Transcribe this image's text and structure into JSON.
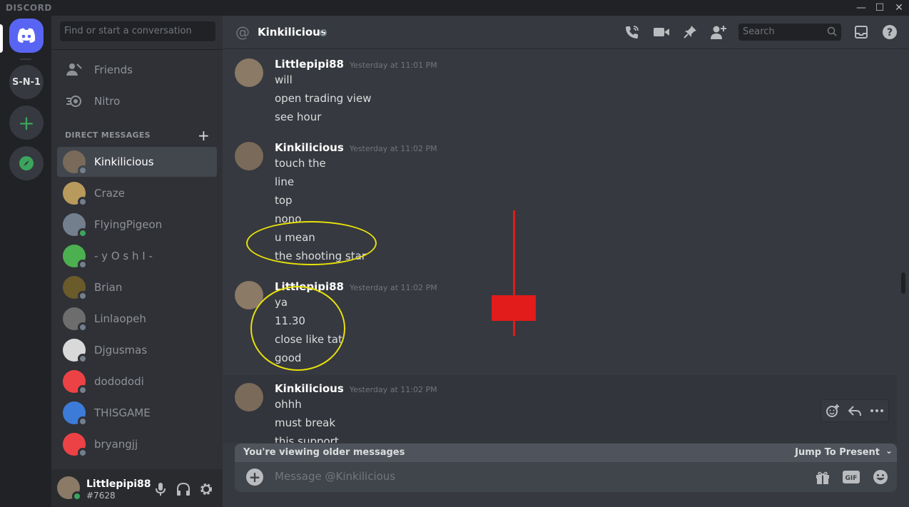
{
  "titlebar": {
    "brand": "DISCORD",
    "minimize": "—",
    "maximize": "☐",
    "close": "✕"
  },
  "rail": {
    "server_text": "S-N-1",
    "add_symbol": "+"
  },
  "dm_sidebar": {
    "search_placeholder": "Find or start a conversation",
    "nav": [
      {
        "label": "Friends",
        "icon": "friends-icon"
      },
      {
        "label": "Nitro",
        "icon": "nitro-icon"
      }
    ],
    "section_title": "DIRECT MESSAGES",
    "add_symbol": "+",
    "dms": [
      {
        "name": "Kinkilicious",
        "status": "offline",
        "color": "#7a6a5a",
        "active": true
      },
      {
        "name": "Craze",
        "status": "offline",
        "color": "#b89a5c"
      },
      {
        "name": "FlyingPigeon",
        "status": "online",
        "color": "#747f8d"
      },
      {
        "name": "- y O s h I -",
        "status": "offline",
        "color": "#4caf50"
      },
      {
        "name": "Brian",
        "status": "offline",
        "color": "#6b5a2a"
      },
      {
        "name": "Linlaopeh",
        "status": "offline",
        "color": "#6d6d6d"
      },
      {
        "name": "Djgusmas",
        "status": "offline",
        "color": "#d9d9d9"
      },
      {
        "name": "dodododi",
        "status": "offline",
        "color": "#ed4245"
      },
      {
        "name": "THISGAME",
        "status": "offline",
        "color": "#3d7bd9"
      },
      {
        "name": "bryangjj",
        "status": "offline",
        "color": "#ed4245"
      }
    ]
  },
  "user_panel": {
    "name": "Littlepipi88",
    "tag": "#7628"
  },
  "chat": {
    "at": "@",
    "title": "Kinkilicious",
    "search_placeholder": "Search",
    "groups": [
      {
        "author": "Littlepipi88",
        "timestamp": "Yesterday at 11:01 PM",
        "lines": [
          "will",
          "open trading view",
          "see hour"
        ]
      },
      {
        "author": "Kinkilicious",
        "timestamp": "Yesterday at 11:02 PM",
        "lines": [
          "touch the",
          "line",
          "top",
          "nono",
          "u mean",
          "the shooting star"
        ]
      },
      {
        "author": "Littlepipi88",
        "timestamp": "Yesterday at 11:02 PM",
        "lines": [
          "ya",
          "11.30",
          "close like tat",
          "good"
        ]
      },
      {
        "author": "Kinkilicious",
        "timestamp": "Yesterday at 11:02 PM",
        "lines": [
          "ohhh",
          "must break",
          "this support"
        ]
      }
    ],
    "older_notice": "You're viewing older messages",
    "jump_label": "Jump To Present",
    "composer_placeholder": "Message @Kinkilicious",
    "gif_label": "GIF"
  },
  "colors": {
    "accent": "#5865f2",
    "annotation_yellow": "#e8e10c",
    "candle_red": "#e21b1b"
  }
}
